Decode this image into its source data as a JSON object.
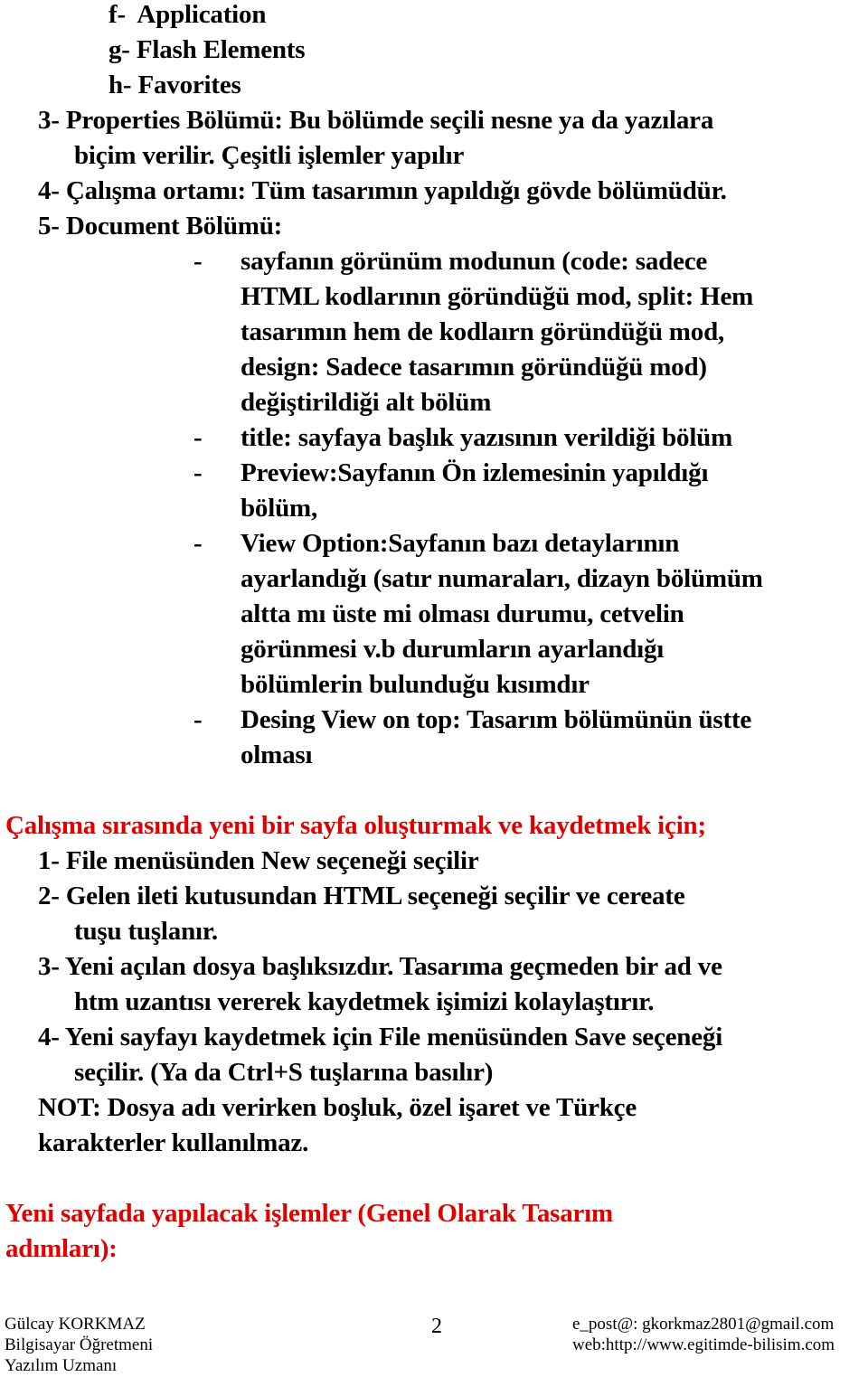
{
  "document": {
    "sublist": [
      {
        "marker": "f-",
        "text": "Application"
      },
      {
        "marker": "g-",
        "text": "Flash Elements"
      },
      {
        "marker": "h-",
        "text": "Favorites"
      }
    ],
    "numbered_top": [
      {
        "marker": "3-",
        "lines": [
          "Properties Bölümü: Bu bölümde seçili nesne ya da yazılara",
          "biçim verilir. Çeşitli işlemler yapılır"
        ]
      },
      {
        "marker": "4-",
        "lines": [
          "Çalışma ortamı: Tüm tasarımın yapıldığı gövde bölümüdür."
        ]
      },
      {
        "marker": "5-",
        "lines": [
          "Document Bölümü:"
        ]
      }
    ],
    "document_bullets": [
      {
        "dash": "-",
        "lines": [
          "sayfanın görünüm modunun (code: sadece",
          "HTML kodlarının göründüğü mod, split: Hem",
          "tasarımın hem de kodlaırn göründüğü mod,",
          "design: Sadece tasarımın göründüğü mod)",
          "değiştirildiği alt bölüm"
        ]
      },
      {
        "dash": "-",
        "lines": [
          " title: sayfaya başlık yazısının verildiği bölüm"
        ]
      },
      {
        "dash": "-",
        "lines": [
          "Preview:Sayfanın Ön izlemesinin yapıldığı",
          "bölüm,"
        ]
      },
      {
        "dash": "-",
        "lines": [
          "View Option:Sayfanın bazı detaylarının",
          "ayarlandığı (satır numaraları, dizayn bölümüm",
          "altta mı üste mi olması durumu, cetvelin",
          "görünmesi v.b durumların ayarlandığı",
          "bölümlerin bulunduğu kısımdır"
        ]
      },
      {
        "dash": "-",
        "lines": [
          "Desing View on top: Tasarım bölümünün üstte",
          "olması"
        ]
      }
    ],
    "heading_new_page": "Çalışma sırasında yeni bir sayfa oluşturmak ve kaydetmek için;",
    "steps": [
      {
        "marker": "1-",
        "lines": [
          "File menüsünden New seçeneği seçilir"
        ]
      },
      {
        "marker": "2-",
        "lines": [
          "Gelen ileti kutusundan HTML seçeneği seçilir ve cereate",
          "tuşu tuşlanır."
        ]
      },
      {
        "marker": "3-",
        "lines": [
          "Yeni açılan dosya başlıksızdır. Tasarıma geçmeden bir ad ve",
          "htm uzantısı vererek kaydetmek işimizi kolaylaştırır."
        ]
      },
      {
        "marker": "4-",
        "lines": [
          "Yeni sayfayı kaydetmek için File menüsünden Save seçeneği",
          "seçilir. (Ya da Ctrl+S tuşlarına basılır)"
        ]
      }
    ],
    "note_lines": [
      "NOT: Dosya adı verirken boşluk, özel işaret ve Türkçe",
      "karakterler kullanılmaz."
    ],
    "heading_design_steps": [
      "Yeni sayfada yapılacak işlemler (Genel Olarak Tasarım",
      "adımları):"
    ],
    "heading_color": "#e00000"
  },
  "footer": {
    "author_name": "Gülcay KORKMAZ",
    "author_title": "Bilgisayar Öğretmeni",
    "author_role": "Yazılım Uzmanı",
    "page_number": "2",
    "email": "e_post@: gkorkmaz2801@gmail.com",
    "web": "web:http://www.egitimde-bilisim.com"
  }
}
